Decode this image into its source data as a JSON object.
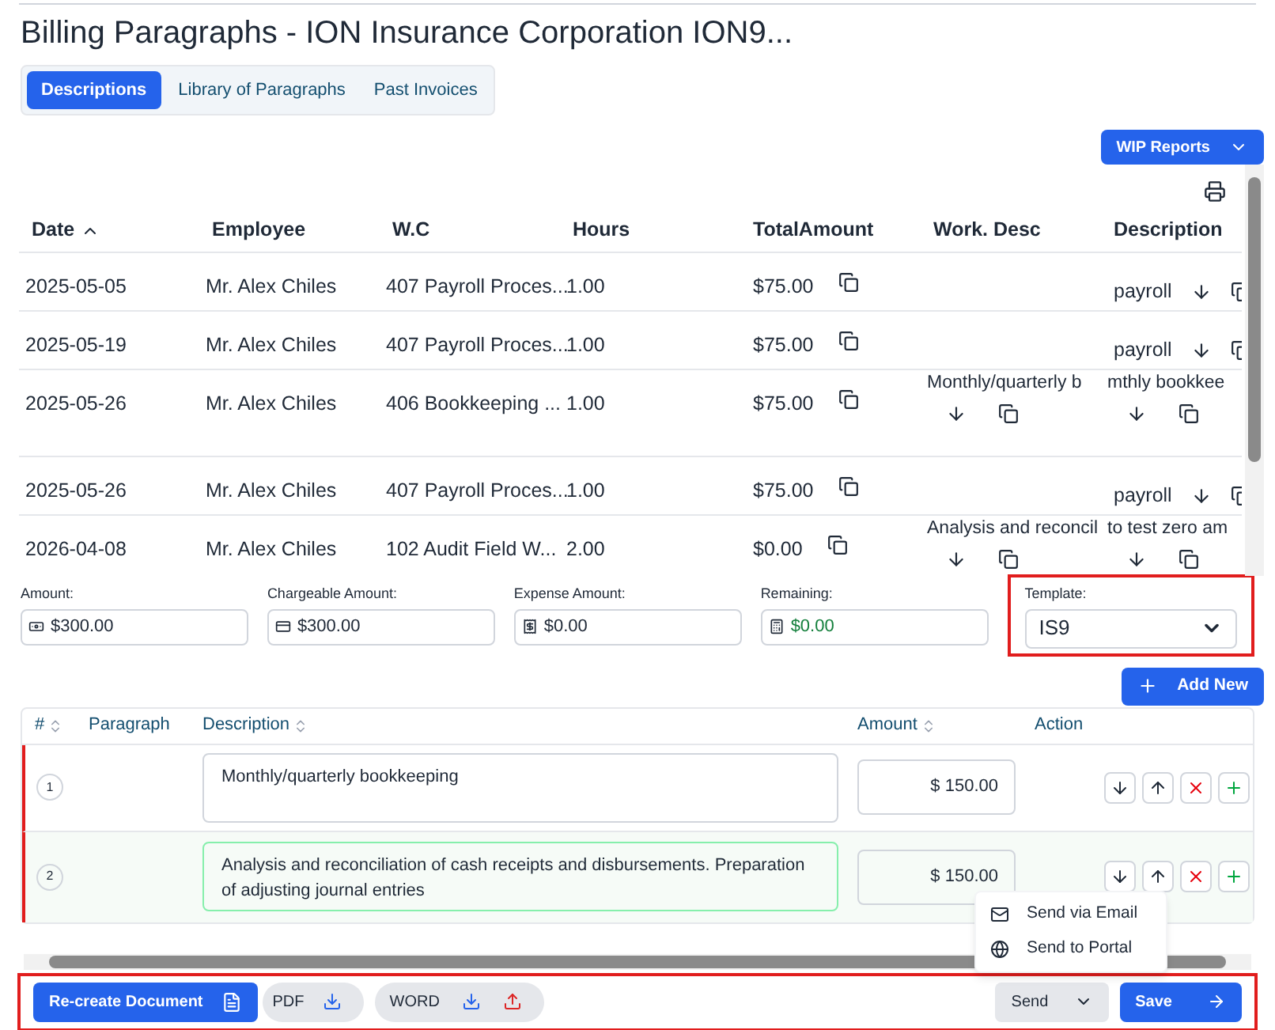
{
  "title": "Billing Paragraphs - ION Insurance Corporation ION9...",
  "tabs": [
    {
      "label": "Descriptions",
      "selected": true
    },
    {
      "label": "Library of Paragraphs",
      "selected": false
    },
    {
      "label": "Past Invoices",
      "selected": false
    }
  ],
  "wip_button": "WIP Reports",
  "table": {
    "columns": [
      {
        "label": "Date",
        "sorted": true
      },
      {
        "label": "Employee",
        "sorted": false
      },
      {
        "label": "W.C",
        "sorted": false
      },
      {
        "label": "Hours",
        "sorted": false
      },
      {
        "label": "TotalAmount",
        "sorted": false
      },
      {
        "label": "Work. Desc",
        "sorted": false
      },
      {
        "label": "Description",
        "sorted": false
      }
    ],
    "rows": [
      {
        "date": "2025-05-05",
        "employee": "Mr. Alex Chiles",
        "wc": "407 Payroll Proces...",
        "hours": "1.00",
        "total_amount": "$75.00",
        "work_desc": "",
        "description": "payroll"
      },
      {
        "date": "2025-05-19",
        "employee": "Mr. Alex Chiles",
        "wc": "407 Payroll Proces...",
        "hours": "1.00",
        "total_amount": "$75.00",
        "work_desc": "",
        "description": "payroll"
      },
      {
        "date": "2025-05-26",
        "employee": "Mr. Alex Chiles",
        "wc": "406 Bookkeeping ...",
        "hours": "1.00",
        "total_amount": "$75.00",
        "work_desc": "Monthly/quarterly b",
        "description": "mthly bookkee"
      },
      {
        "date": "2025-05-26",
        "employee": "Mr. Alex Chiles",
        "wc": "407 Payroll Proces...",
        "hours": "1.00",
        "total_amount": "$75.00",
        "work_desc": "",
        "description": "payroll"
      },
      {
        "date": "2026-04-08",
        "employee": "Mr. Alex Chiles",
        "wc": "102 Audit Field W...",
        "hours": "2.00",
        "total_amount": "$0.00",
        "work_desc": "Analysis and reconcil",
        "description": "to test zero am"
      }
    ]
  },
  "summary": [
    {
      "label": "Amount:",
      "value": "$300.00",
      "kind": "cash",
      "color": "#1f2937"
    },
    {
      "label": "Chargeable Amount:",
      "value": "$300.00",
      "kind": "card",
      "color": "#1f2937"
    },
    {
      "label": "Expense Amount:",
      "value": "$0.00",
      "kind": "expense",
      "color": "#1f2937"
    },
    {
      "label": "Remaining:",
      "value": "$0.00",
      "kind": "calc",
      "color": "#15803d"
    }
  ],
  "template": {
    "label": "Template:",
    "value": "IS9"
  },
  "add_button": "Add New",
  "paragraphs": {
    "columns": [
      {
        "label": "#",
        "sortable": true
      },
      {
        "label": "Paragraph",
        "sortable": false
      },
      {
        "label": "Description",
        "sortable": true
      },
      {
        "label": "Amount",
        "sortable": true
      },
      {
        "label": "Action",
        "sortable": false
      }
    ],
    "rows": [
      {
        "number": "1",
        "description": "Monthly/quarterly bookkeeping",
        "amount": "$ 150.00",
        "selected": false
      },
      {
        "number": "2",
        "description": "Analysis and reconciliation of cash receipts and disbursements. Preparation of adjusting journal entries",
        "amount": "$ 150.00",
        "selected": true
      }
    ]
  },
  "send_menu": [
    "Send via Email",
    "Send to Portal"
  ],
  "footer": {
    "recreate": "Re-create Document",
    "pdf": "PDF",
    "word": "WORD",
    "send": "Send",
    "save": "Save"
  }
}
